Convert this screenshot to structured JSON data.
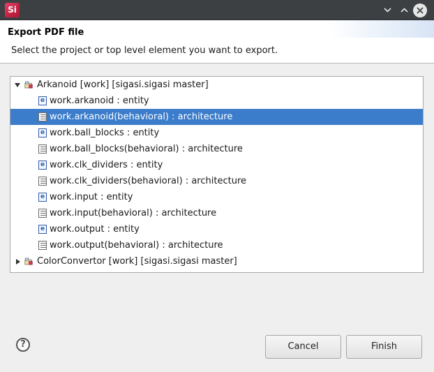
{
  "window": {
    "app_icon_text": "Si",
    "minimize_glyph": "⌄",
    "maximize_glyph": "⌃",
    "close_glyph": "✕"
  },
  "header": {
    "title": "Export PDF file",
    "message": "Select the project or top level element you want to export."
  },
  "tree": {
    "items": [
      {
        "label": "Arkanoid [work] [sigasi.sigasi master]",
        "kind": "project",
        "expanded": true,
        "selected": false
      },
      {
        "label": "work.arkanoid : entity",
        "kind": "entity",
        "selected": false
      },
      {
        "label": "work.arkanoid(behavioral) : architecture",
        "kind": "architecture",
        "selected": true
      },
      {
        "label": "work.ball_blocks : entity",
        "kind": "entity",
        "selected": false
      },
      {
        "label": "work.ball_blocks(behavioral) : architecture",
        "kind": "architecture",
        "selected": false
      },
      {
        "label": "work.clk_dividers : entity",
        "kind": "entity",
        "selected": false
      },
      {
        "label": "work.clk_dividers(behavioral) : architecture",
        "kind": "architecture",
        "selected": false
      },
      {
        "label": "work.input : entity",
        "kind": "entity",
        "selected": false
      },
      {
        "label": "work.input(behavioral) : architecture",
        "kind": "architecture",
        "selected": false
      },
      {
        "label": "work.output : entity",
        "kind": "entity",
        "selected": false
      },
      {
        "label": "work.output(behavioral) : architecture",
        "kind": "architecture",
        "selected": false
      },
      {
        "label": "ColorConvertor [work] [sigasi.sigasi master]",
        "kind": "project",
        "expanded": false,
        "selected": false
      }
    ],
    "entity_icon_letter": "e"
  },
  "footer": {
    "help_glyph": "?",
    "cancel_label": "Cancel",
    "finish_label": "Finish"
  },
  "colors": {
    "selection": "#3b7ccb",
    "titlebar": "#3c4043",
    "app_icon": "#c0213f"
  }
}
